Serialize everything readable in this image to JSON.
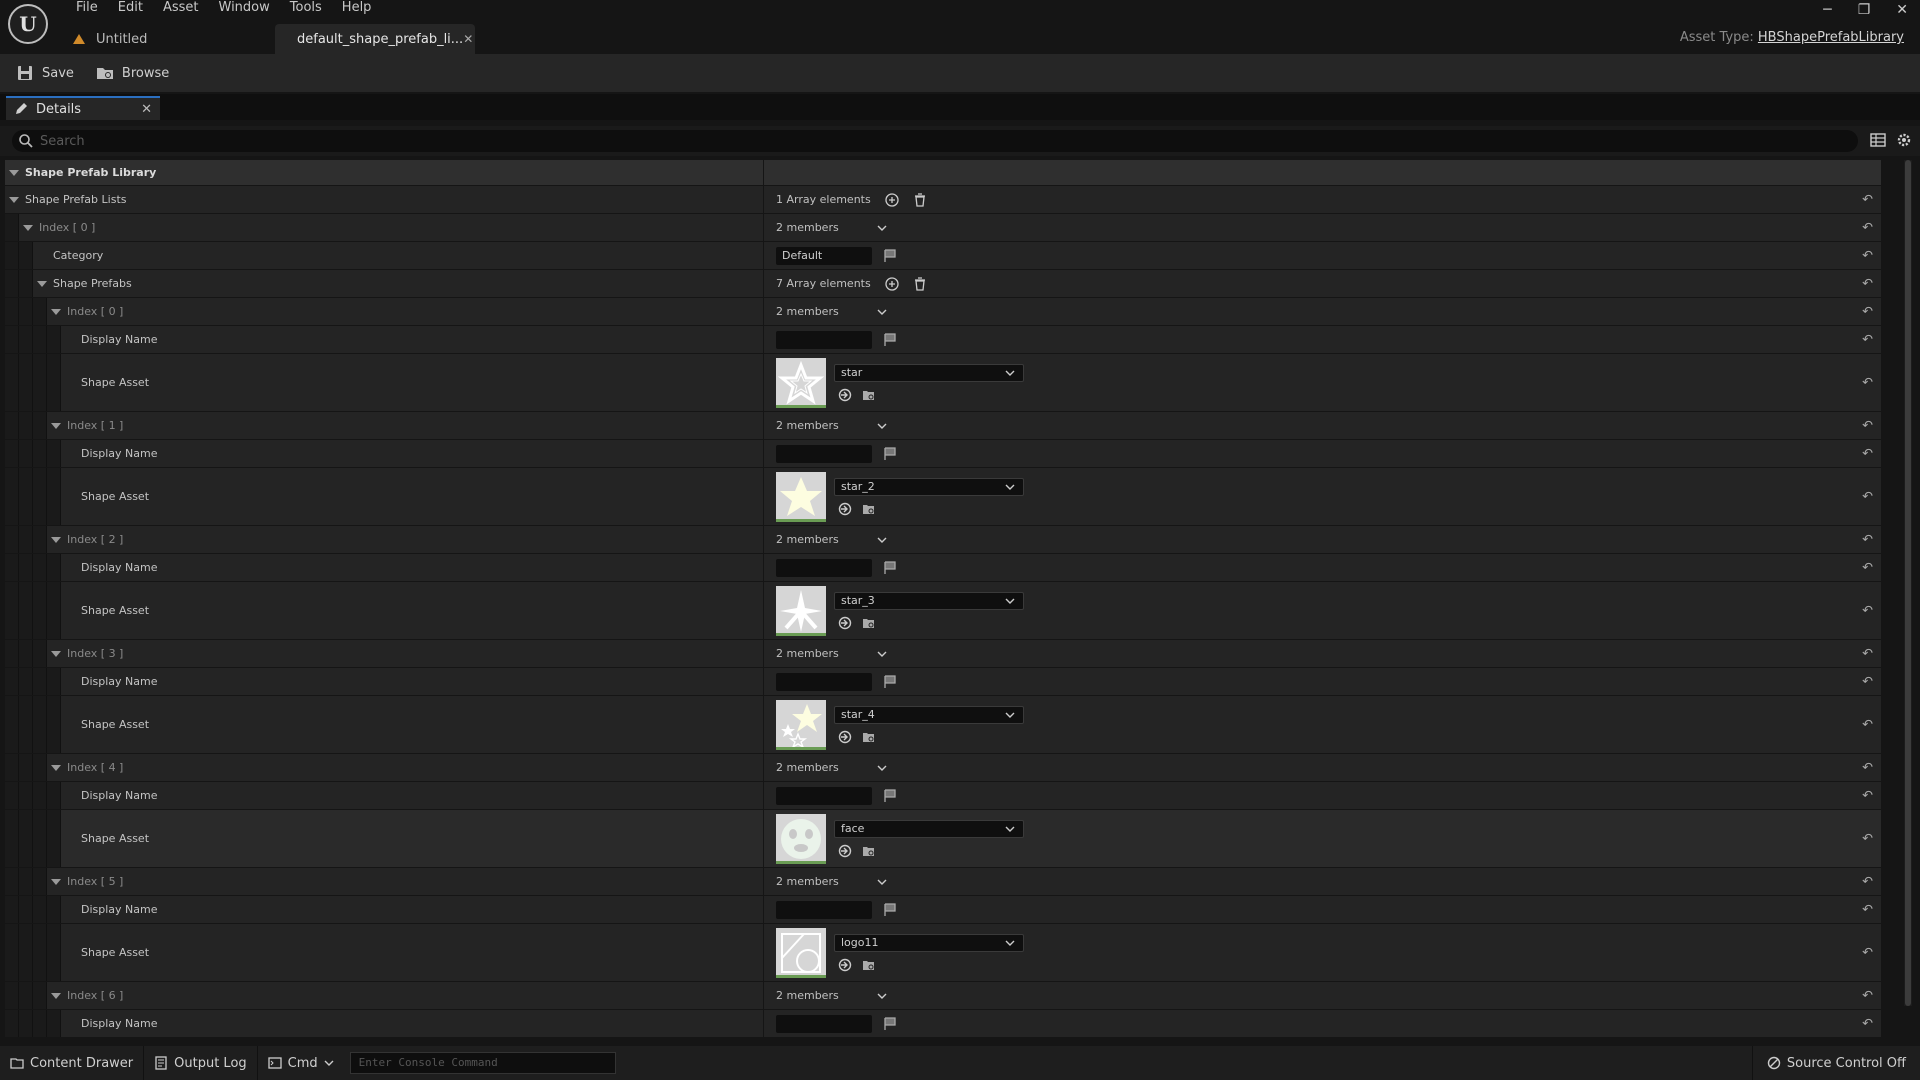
{
  "menu": [
    "File",
    "Edit",
    "Asset",
    "Window",
    "Tools",
    "Help"
  ],
  "tabs": [
    {
      "label": "Untitled"
    },
    {
      "label": "default_shape_prefab_li..."
    }
  ],
  "asset_type": {
    "label": "Asset Type:",
    "value": "HBShapePrefabLibrary"
  },
  "toolbar": {
    "save": "Save",
    "browse": "Browse"
  },
  "panel": {
    "tab": "Details"
  },
  "search": {
    "placeholder": "Search"
  },
  "tree": {
    "section": "Shape Prefab Library",
    "lists": {
      "label": "Shape Prefab Lists",
      "value": "1 Array elements"
    },
    "index0": {
      "label": "Index [ 0 ]",
      "value": "2 members"
    },
    "category": {
      "label": "Category",
      "value": "Default"
    },
    "prefabs": {
      "label": "Shape Prefabs",
      "value": "7 Array elements"
    },
    "items": [
      {
        "index": "Index [ 0 ]",
        "members": "2 members",
        "display_name": "Display Name",
        "shape_asset": "Shape Asset",
        "asset": "star"
      },
      {
        "index": "Index [ 1 ]",
        "members": "2 members",
        "display_name": "Display Name",
        "shape_asset": "Shape Asset",
        "asset": "star_2"
      },
      {
        "index": "Index [ 2 ]",
        "members": "2 members",
        "display_name": "Display Name",
        "shape_asset": "Shape Asset",
        "asset": "star_3"
      },
      {
        "index": "Index [ 3 ]",
        "members": "2 members",
        "display_name": "Display Name",
        "shape_asset": "Shape Asset",
        "asset": "star_4"
      },
      {
        "index": "Index [ 4 ]",
        "members": "2 members",
        "display_name": "Display Name",
        "shape_asset": "Shape Asset",
        "asset": "face"
      },
      {
        "index": "Index [ 5 ]",
        "members": "2 members",
        "display_name": "Display Name",
        "shape_asset": "Shape Asset",
        "asset": "logo11"
      },
      {
        "index": "Index [ 6 ]",
        "members": "2 members",
        "display_name": "Display Name"
      }
    ]
  },
  "statusbar": {
    "content_drawer": "Content Drawer",
    "output_log": "Output Log",
    "cmd": "Cmd",
    "console_placeholder": "Enter Console Command",
    "source_control": "Source Control Off"
  }
}
